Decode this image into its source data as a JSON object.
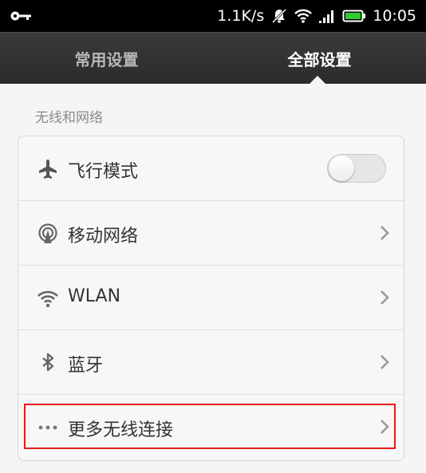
{
  "status_bar": {
    "speed": "1.1K/s",
    "time": "10:05",
    "icons": [
      "key-icon",
      "mute-icon",
      "wifi-icon",
      "signal-icon",
      "battery-icon"
    ]
  },
  "tabs": [
    {
      "label": "常用设置",
      "active": false
    },
    {
      "label": "全部设置",
      "active": true
    }
  ],
  "section": {
    "title": "无线和网络"
  },
  "rows": [
    {
      "label": "飞行模式",
      "icon": "airplane-icon",
      "control": "toggle",
      "toggle_on": false
    },
    {
      "label": "移动网络",
      "icon": "mobile-network-icon",
      "control": "chevron"
    },
    {
      "label": "WLAN",
      "icon": "wifi-icon",
      "control": "chevron"
    },
    {
      "label": "蓝牙",
      "icon": "bluetooth-icon",
      "control": "chevron"
    },
    {
      "label": "更多无线连接",
      "icon": "more-icon",
      "control": "chevron"
    }
  ],
  "colors": {
    "highlight": "#e41b1b",
    "tabbar": "#333333",
    "statusbar": "#000000"
  }
}
